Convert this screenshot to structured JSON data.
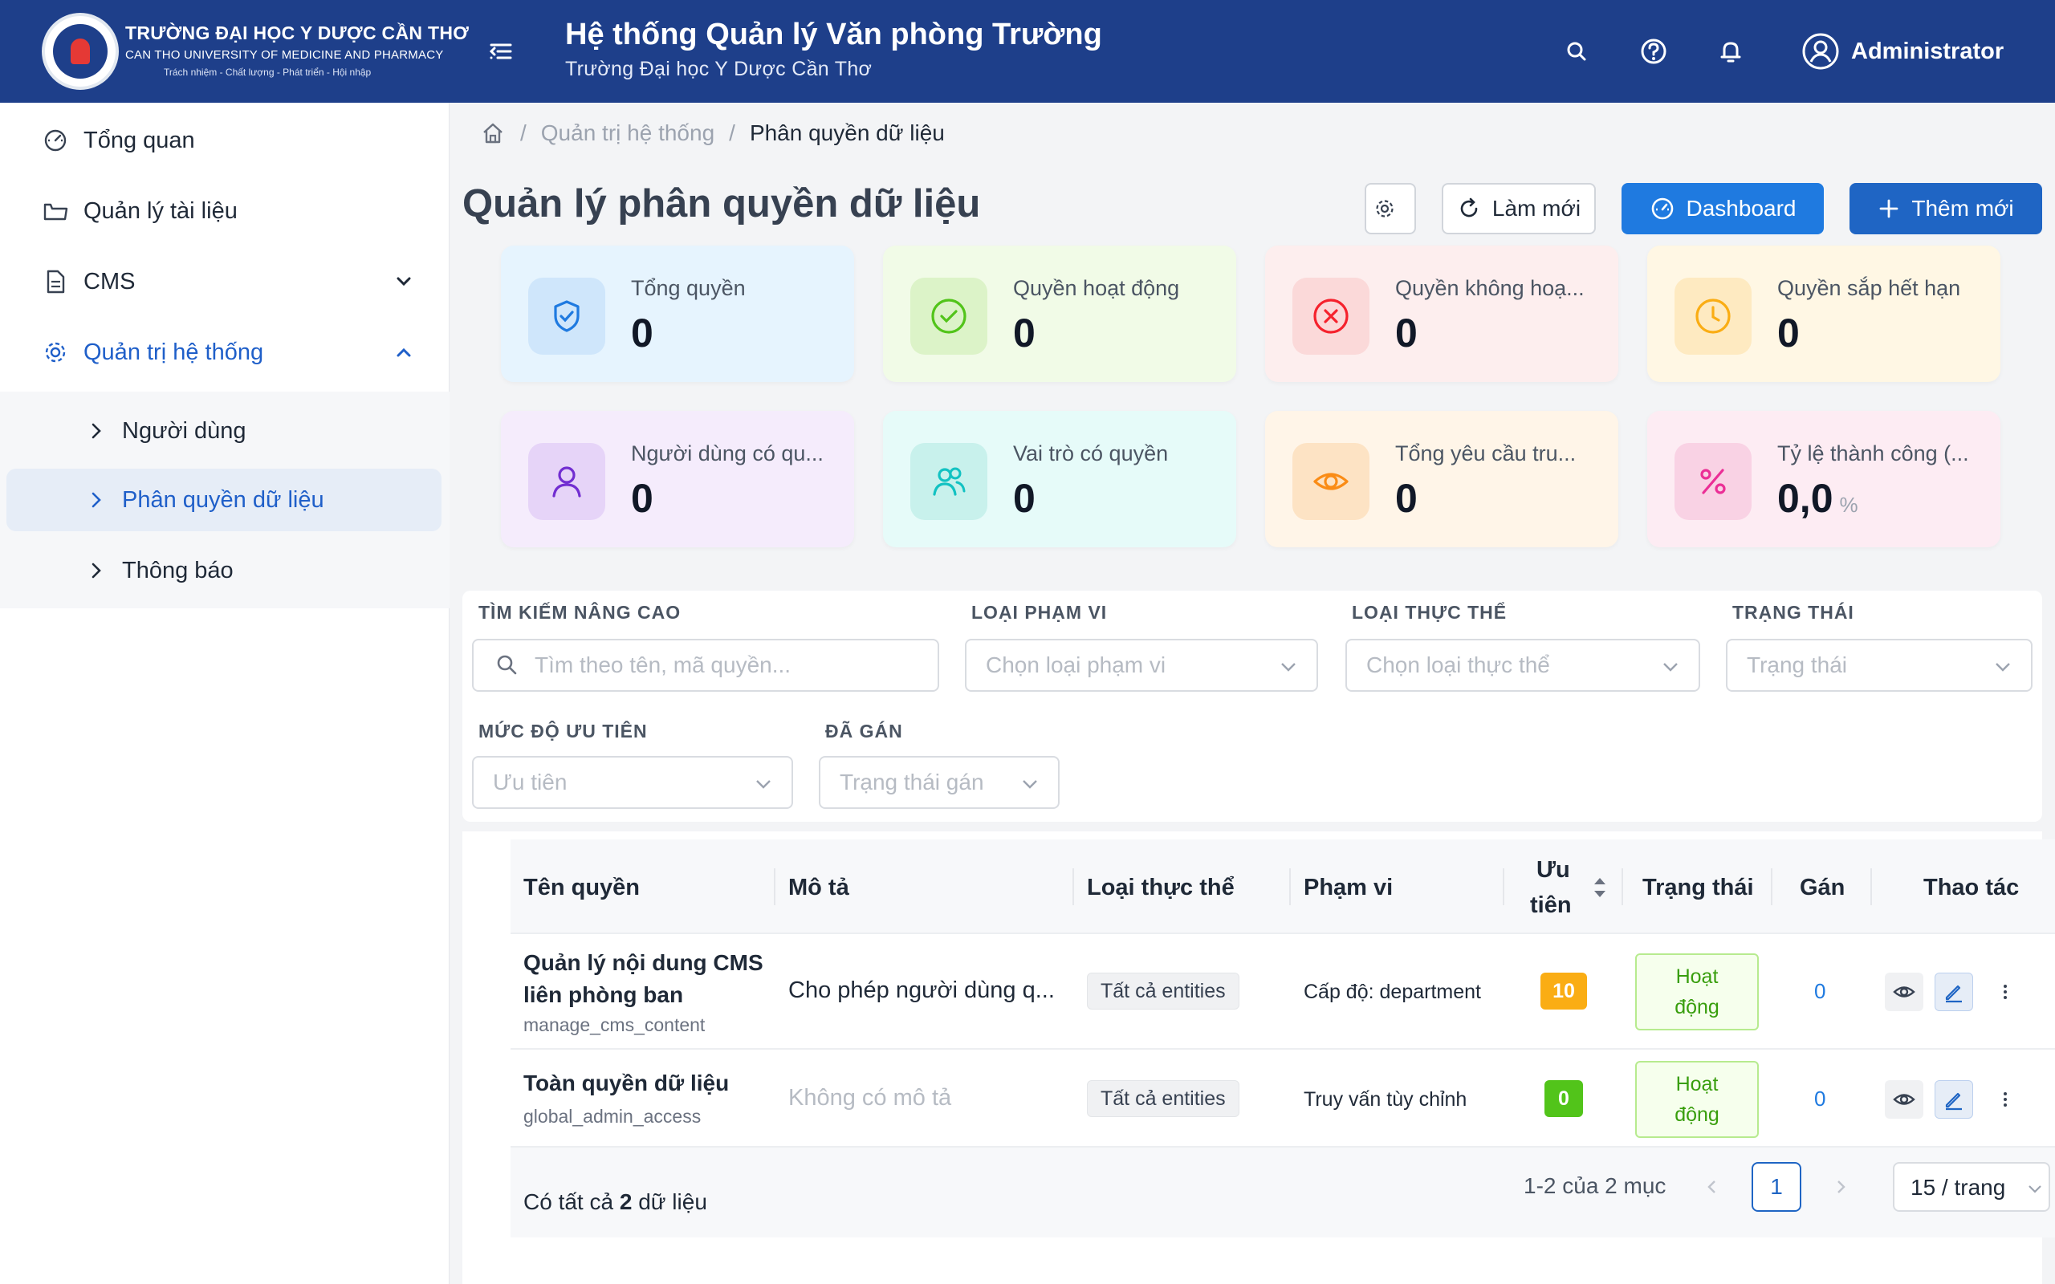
{
  "header": {
    "school_vn": "TRƯỜNG ĐẠI HỌC Y DƯỢC CẦN THƠ",
    "school_en": "CAN THO UNIVERSITY OF MEDICINE AND PHARMACY",
    "school_motto": "Trách nhiệm - Chất lượng - Phát triển - Hội nhập",
    "title": "Hệ thống Quản lý Văn phòng Trường",
    "subtitle": "Trường Đại học Y Dược Cần Thơ",
    "user": "Administrator",
    "colors": {
      "primary": "#1e3f8a",
      "accent": "#1f7ae0"
    }
  },
  "sidebar": {
    "items": [
      {
        "label": "Tổng quan",
        "icon": "dashboard-icon"
      },
      {
        "label": "Quản lý tài liệu",
        "icon": "folder-icon"
      },
      {
        "label": "CMS",
        "icon": "file-icon"
      },
      {
        "label": "Quản trị hệ thống",
        "icon": "gear-icon"
      }
    ],
    "sub_items": [
      {
        "label": "Người dùng"
      },
      {
        "label": "Phân quyền dữ liệu"
      },
      {
        "label": "Thông báo"
      }
    ]
  },
  "breadcrumb": {
    "parent": "Quản trị hệ thống",
    "current": "Phân quyền dữ liệu"
  },
  "page": {
    "title": "Quản lý phân quyền dữ liệu"
  },
  "toolbar": {
    "refresh": "Làm mới",
    "dashboard": "Dashboard",
    "add": "Thêm mới"
  },
  "stats": [
    {
      "label": "Tổng quyền",
      "value": "0",
      "color": "#1f7ae0"
    },
    {
      "label": "Quyền hoạt động",
      "value": "0",
      "color": "#52c41a"
    },
    {
      "label": "Quyền không hoạ...",
      "value": "0",
      "color": "#f5222d"
    },
    {
      "label": "Quyền sắp hết hạn",
      "value": "0",
      "color": "#faad14"
    },
    {
      "label": "Người dùng có qu...",
      "value": "0",
      "color": "#722ed1"
    },
    {
      "label": "Vai trò có quyền",
      "value": "0",
      "color": "#13c2c2"
    },
    {
      "label": "Tổng yêu cầu tru...",
      "value": "0",
      "color": "#fa8c16"
    },
    {
      "label": "Tỷ lệ thành công (...",
      "value": "0,0",
      "unit": "%",
      "color": "#eb2f96"
    }
  ],
  "filters": {
    "search_label": "TÌM KIẾM NÂNG CAO",
    "search_placeholder": "Tìm theo tên, mã quyền...",
    "scope_label": "LOẠI PHẠM VI",
    "scope_placeholder": "Chọn loại phạm vi",
    "entity_label": "LOẠI THỰC THỂ",
    "entity_placeholder": "Chọn loại thực thể",
    "status_label": "TRẠNG THÁI",
    "status_placeholder": "Trạng thái",
    "priority_label": "MỨC ĐỘ ƯU TIÊN",
    "priority_placeholder": "Ưu tiên",
    "assigned_label": "ĐÃ GÁN",
    "assigned_placeholder": "Trạng thái gán"
  },
  "table": {
    "columns": [
      "Tên quyền",
      "Mô tả",
      "Loại thực thể",
      "Phạm vi",
      "Ưu",
      "tiên",
      "Trạng thái",
      "Gán",
      "Thao tác"
    ],
    "rows": [
      {
        "name_line1": "Quản lý nội dung CMS",
        "name_line2": "liên phòng ban",
        "code": "manage_cms_content",
        "description": "Cho phép người dùng q...",
        "entity": "Tất cả entities",
        "scope": "Cấp độ: department",
        "priority": "10",
        "priority_color": "#faad14",
        "status_line1": "Hoạt",
        "status_line2": "động",
        "assigned": "0"
      },
      {
        "name_line1": "Toàn quyền dữ liệu",
        "code": "global_admin_access",
        "description": "Không có mô tả",
        "entity": "Tất cả entities",
        "scope": "Truy vấn tùy chỉnh",
        "priority": "0",
        "priority_color": "#52c41a",
        "status_line1": "Hoạt",
        "status_line2": "động",
        "assigned": "0"
      }
    ],
    "total_prefix": "Có tất cả",
    "total_count": "2",
    "total_suffix": "dữ liệu",
    "range": "1-2 của 2 mục",
    "page": "1",
    "page_size": "15 / trang"
  }
}
